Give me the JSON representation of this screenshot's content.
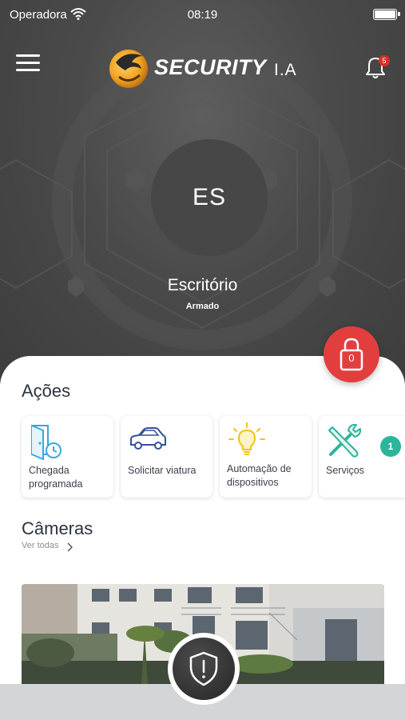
{
  "status_bar": {
    "carrier": "Operadora",
    "time": "08:19"
  },
  "header": {
    "logo_word": "SECURITY",
    "logo_suffix": "I.A",
    "notifications_count": "5"
  },
  "location": {
    "initials": "ES",
    "name": "Escritório",
    "status": "Armado"
  },
  "lock_button": {
    "count": "0"
  },
  "actions": {
    "title": "Ações",
    "items": [
      {
        "label": "Chegada programada",
        "icon": "door-clock-icon"
      },
      {
        "label": "Solicitar viatura",
        "icon": "car-icon"
      },
      {
        "label": "Automação de dispositivos",
        "icon": "lightbulb-icon"
      },
      {
        "label": "Serviços",
        "icon": "tools-icon",
        "badge": "1"
      }
    ]
  },
  "cameras": {
    "title": "Câmeras",
    "see_all": "Ver todas"
  },
  "colors": {
    "hero_bg": "#4a4a4a",
    "lock_red": "#e23e3e",
    "badge_teal": "#2bb59a",
    "logo_orange": "#f0a020",
    "icon_blue": "#3aa7dd",
    "icon_navy": "#3450a0",
    "icon_yellow": "#f2c21a",
    "icon_teal": "#2bb59a"
  }
}
